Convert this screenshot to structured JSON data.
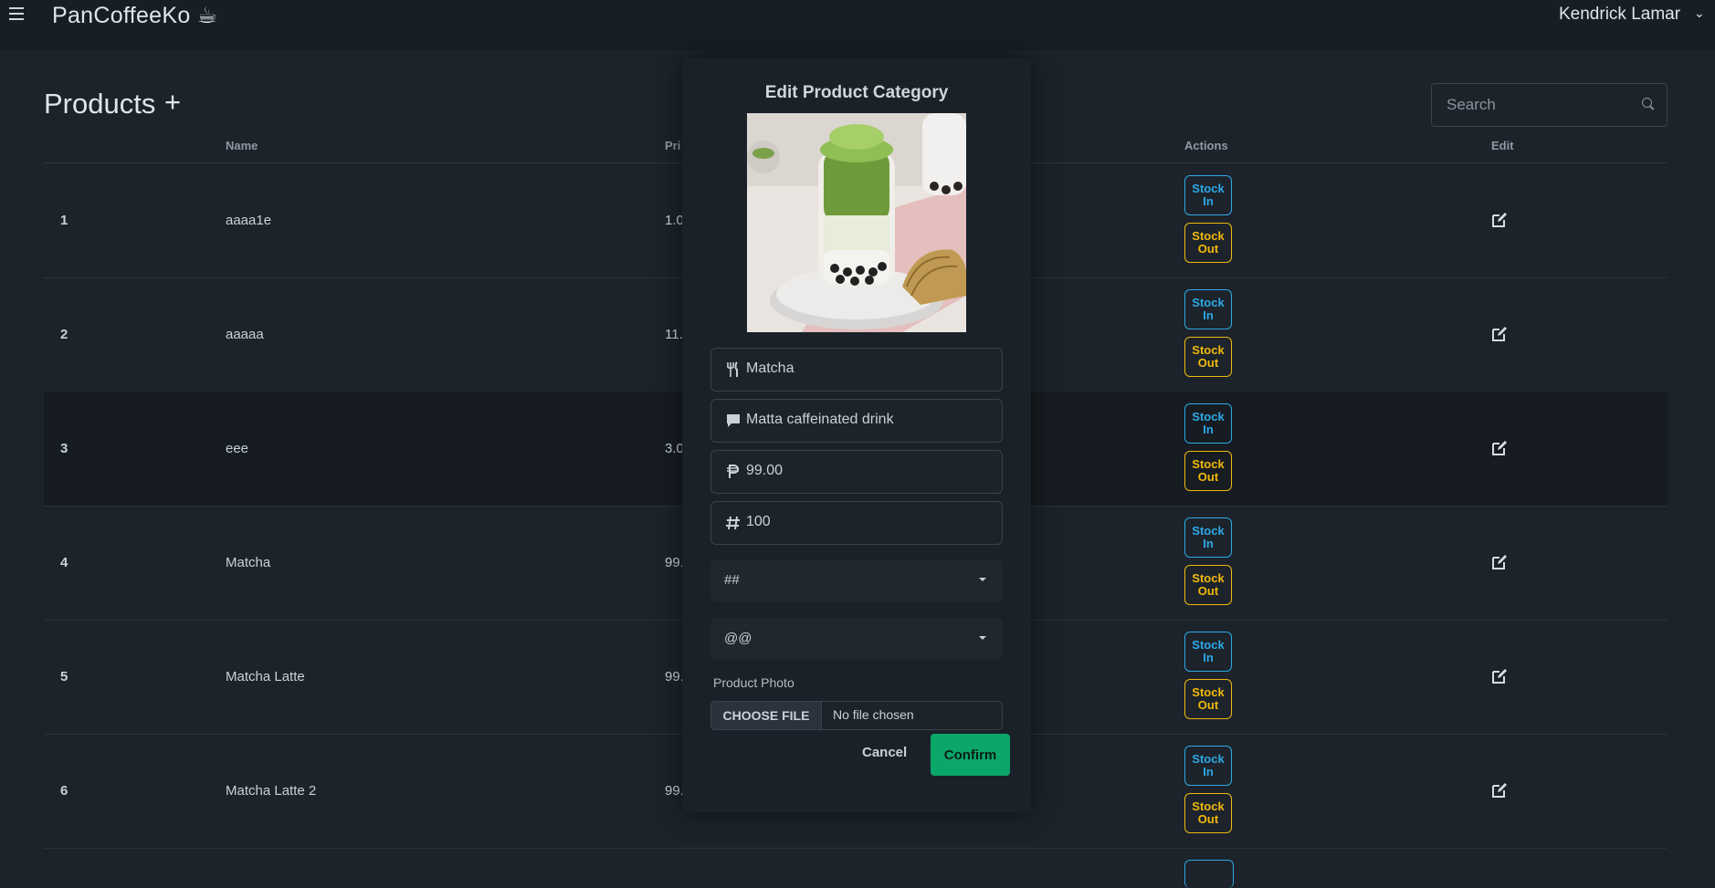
{
  "app": {
    "brand": "PanCoffeeKo ☕",
    "user": "Kendrick Lamar"
  },
  "page": {
    "title": "Products",
    "add_symbol": "+",
    "search_placeholder": "Search"
  },
  "table": {
    "columns": {
      "name": "Name",
      "price": "Pri",
      "actions": "Actions",
      "edit": "Edit"
    },
    "stock_in_label": "Stock\nIn",
    "stock_out_label": "Stock\nOut",
    "rows": [
      {
        "index": "1",
        "name": "aaaa1e",
        "price": "1.0"
      },
      {
        "index": "2",
        "name": "aaaaa",
        "price": "11."
      },
      {
        "index": "3",
        "name": "eee",
        "price": "3.0"
      },
      {
        "index": "4",
        "name": "Matcha",
        "price": "99."
      },
      {
        "index": "5",
        "name": "Matcha Latte",
        "price": "99."
      },
      {
        "index": "6",
        "name": "Matcha Latte 2",
        "price": "99."
      }
    ]
  },
  "modal": {
    "title": "Edit Product Category",
    "name_value": "Matcha",
    "description_value": "Matta caffeinated drink",
    "price_value": "99.00",
    "quantity_value": "100",
    "category_select": "##",
    "type_select": "@@",
    "photo_label": "Product Photo",
    "choose_file": "CHOOSE FILE",
    "no_file": "No file chosen",
    "cancel": "Cancel",
    "confirm": "Confirm"
  },
  "colors": {
    "stock_in": "#2ea8e6",
    "stock_out": "#f0b90b",
    "confirm": "#0aa66a"
  }
}
